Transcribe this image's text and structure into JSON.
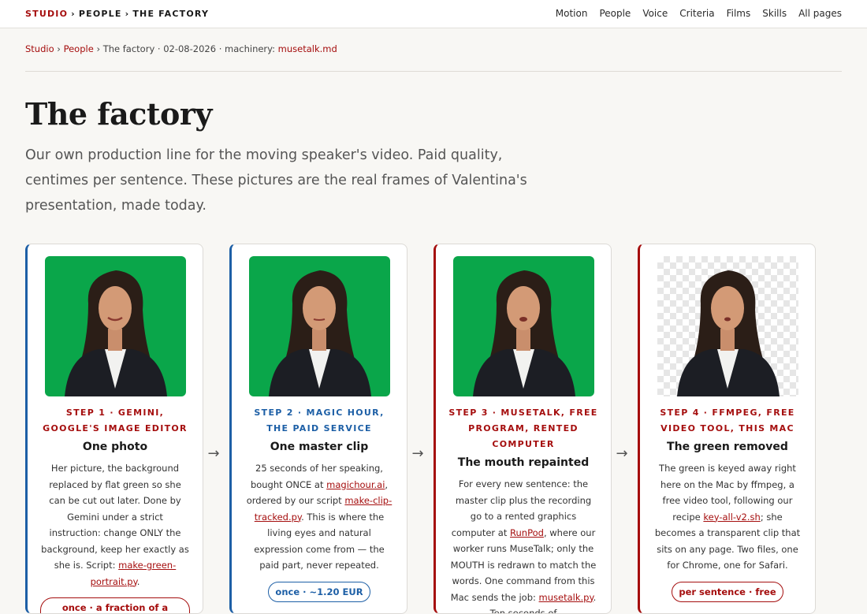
{
  "topbar": {
    "brand": [
      "STUDIO",
      "PEOPLE",
      "THE FACTORY"
    ],
    "brand_sep": "›",
    "nav": [
      "Motion",
      "People",
      "Voice",
      "Criteria",
      "Films",
      "Skills",
      "All pages"
    ]
  },
  "breadcrumb": {
    "studio": "Studio",
    "sep": "›",
    "people": "People",
    "current": "The factory · 02-08-2026 · machinery: ",
    "file": "musetalk.md"
  },
  "page": {
    "title": "The factory",
    "lead": "Our own production line for the moving speaker's video. Paid quality, centimes per sentence. These pictures are the real frames of Valentina's presentation, made today."
  },
  "arrow_glyph": "→",
  "colors": {
    "accent_red": "#a50e0e",
    "accent_blue": "#1d5fa6",
    "green_screen": "#0aa64a"
  },
  "steps": [
    {
      "label": "STEP 1 · GEMINI, GOOGLE'S IMAGE EDITOR",
      "title": "One photo",
      "desc": [
        "Her picture, the background replaced by flat green so she can be cut out later. Done by Gemini under a strict instruction: change ONLY the background, keep her exactly as she is. Script: ",
        "."
      ],
      "link": "make-green-portrait.py",
      "pill": "once · a fraction of a centime"
    },
    {
      "label": "STEP 2 · MAGIC HOUR, THE PAID SERVICE",
      "title": "One master clip",
      "desc": [
        "25 seconds of her speaking, bought ONCE at ",
        ", ordered by our script ",
        ". This is where the living eyes and natural expression come from — the paid part, never repeated."
      ],
      "links": [
        "magichour.ai",
        "make-clip-tracked.py"
      ],
      "pill": "once · ~1.20 EUR"
    },
    {
      "label": "STEP 3 · MUSETALK, FREE PROGRAM, RENTED COMPUTER",
      "title": "The mouth repainted",
      "desc": [
        "For every new sentence: the master clip plus the recording go to a rented graphics computer at ",
        ", where our worker runs MuseTalk; only the MOUTH is redrawn to match the words. One command from this Mac sends the job: ",
        ". Ten seconds of"
      ],
      "links": [
        "RunPod",
        "musetalk.py"
      ]
    },
    {
      "label": "STEP 4 · FFMPEG, FREE VIDEO TOOL, THIS MAC",
      "title": "The green removed",
      "desc": [
        "The green is keyed away right here on the Mac by ffmpeg, a free video tool, following our recipe ",
        "; she becomes a transparent clip that sits on any page. Two files, one for Chrome, one for Safari."
      ],
      "link": "key-all-v2.sh",
      "pill": "per sentence · free"
    }
  ]
}
